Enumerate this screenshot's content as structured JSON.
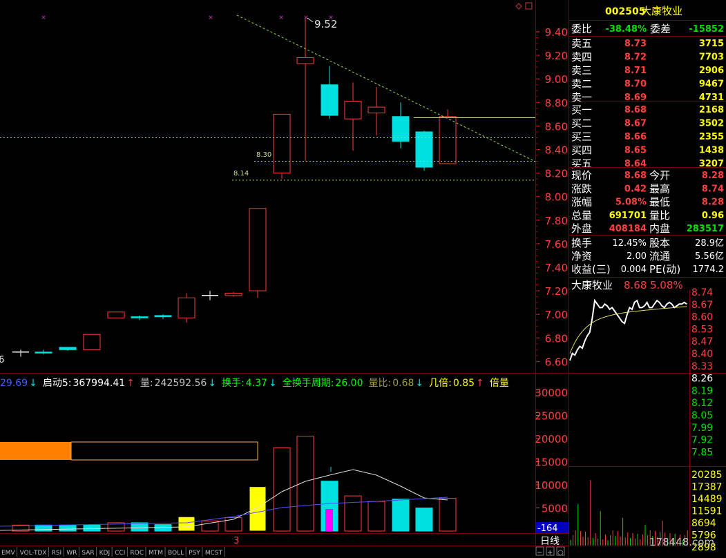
{
  "stock": {
    "code": "002505",
    "name": "大康牧业"
  },
  "colors": {
    "up": "#ff3c3c",
    "down": "#00e0e0",
    "yellow": "#ffff00",
    "green": "#00e000",
    "white": "#ffffff",
    "grid": "#7a0000",
    "orange": "#ff8000",
    "magenta": "#ff00ff"
  },
  "price_axis": {
    "ticks": [
      "9.40",
      "9.20",
      "9.00",
      "8.80",
      "8.60",
      "8.40",
      "8.20",
      "8.00",
      "7.80",
      "7.60",
      "7.40",
      "7.20",
      "7.00",
      "6.80",
      "6.60"
    ]
  },
  "volume_axis": {
    "ticks": [
      "30000",
      "25000",
      "20000",
      "15000",
      "10000",
      "5000"
    ]
  },
  "candles": [
    {
      "o": 6.67,
      "h": 6.7,
      "l": 6.64,
      "c": 6.68,
      "dir": "flat"
    },
    {
      "o": 6.68,
      "h": 6.7,
      "l": 6.66,
      "c": 6.68,
      "dir": "down"
    },
    {
      "o": 6.7,
      "h": 6.72,
      "l": 6.69,
      "c": 6.72,
      "dir": "down"
    },
    {
      "o": 6.7,
      "h": 6.83,
      "l": 6.7,
      "c": 6.83,
      "dir": "up"
    },
    {
      "o": 6.97,
      "h": 7.02,
      "l": 6.97,
      "c": 7.02,
      "dir": "up"
    },
    {
      "o": 6.97,
      "h": 6.99,
      "l": 6.95,
      "c": 6.98,
      "dir": "down"
    },
    {
      "o": 6.99,
      "h": 7.0,
      "l": 6.96,
      "c": 6.98,
      "dir": "down"
    },
    {
      "o": 6.97,
      "h": 7.18,
      "l": 6.93,
      "c": 7.14,
      "dir": "up"
    },
    {
      "o": 7.16,
      "h": 7.2,
      "l": 7.12,
      "c": 7.16,
      "dir": "flat"
    },
    {
      "o": 7.16,
      "h": 7.19,
      "l": 7.15,
      "c": 7.18,
      "dir": "up"
    },
    {
      "o": 7.2,
      "h": 7.9,
      "l": 7.14,
      "c": 7.9,
      "dir": "up"
    },
    {
      "o": 8.2,
      "h": 8.7,
      "l": 8.15,
      "c": 8.7,
      "dir": "up"
    },
    {
      "o": 9.13,
      "h": 9.52,
      "l": 8.3,
      "c": 9.18,
      "dir": "up"
    },
    {
      "o": 8.95,
      "h": 9.11,
      "l": 8.66,
      "c": 8.69,
      "dir": "down"
    },
    {
      "o": 8.66,
      "h": 8.97,
      "l": 8.39,
      "c": 8.81,
      "dir": "up"
    },
    {
      "o": 8.71,
      "h": 8.93,
      "l": 8.52,
      "c": 8.76,
      "dir": "up"
    },
    {
      "o": 8.68,
      "h": 8.8,
      "l": 8.41,
      "c": 8.47,
      "dir": "down"
    },
    {
      "o": 8.55,
      "h": 8.56,
      "l": 8.22,
      "c": 8.25,
      "dir": "down"
    },
    {
      "o": 8.28,
      "h": 8.74,
      "l": 8.28,
      "c": 8.68,
      "dir": "up"
    }
  ],
  "volumes": [
    {
      "v": 1300,
      "dir": "up"
    },
    {
      "v": 1300,
      "dir": "down"
    },
    {
      "v": 1300,
      "dir": "down"
    },
    {
      "v": 1300,
      "dir": "down"
    },
    {
      "v": 1800,
      "dir": "up"
    },
    {
      "v": 1800,
      "dir": "down"
    },
    {
      "v": 1400,
      "dir": "down"
    },
    {
      "v": 3100,
      "dir": "yellow"
    },
    {
      "v": 2200,
      "dir": "up"
    },
    {
      "v": 2900,
      "dir": "up"
    },
    {
      "v": 9600,
      "dir": "yellow"
    },
    {
      "v": 18000,
      "dir": "up"
    },
    {
      "v": 20500,
      "dir": "up"
    },
    {
      "v": 10800,
      "dir": "down"
    },
    {
      "v": 7600,
      "dir": "up"
    },
    {
      "v": 6400,
      "dir": "up"
    },
    {
      "v": 6900,
      "dir": "down"
    },
    {
      "v": 5000,
      "dir": "down"
    },
    {
      "v": 7100,
      "dir": "up"
    }
  ],
  "annotations": {
    "peak_label": "9.52",
    "support1": "8.30",
    "support2": "8.14",
    "left_cut": "6"
  },
  "indicator_bar": {
    "val0": "29.69",
    "qidong_label": "启动5:",
    "qidong_val": "367994.41",
    "liang_label": "量:",
    "liang_val": "242592.56",
    "huanshou_label": "换手:",
    "huanshou_val": "4.37",
    "quanhuan_label": "全换手周期:",
    "quanhuan_val": "26.00",
    "liangbi_label": "量比:",
    "liangbi_val": "0.68",
    "jibei_label": "几倍:",
    "jibei_val": "0.85",
    "beiliang_label": "倍量",
    "arrow_up": "↑",
    "arrow_down": "↓"
  },
  "orderbook": {
    "weibi_label": "委比",
    "weibi_val": "-38.48%",
    "weicha_label": "委差",
    "weicha_val": "-15852",
    "sells": [
      {
        "label": "卖五",
        "price": "8.73",
        "vol": "3715"
      },
      {
        "label": "卖四",
        "price": "8.72",
        "vol": "7703"
      },
      {
        "label": "卖三",
        "price": "8.71",
        "vol": "2906"
      },
      {
        "label": "卖二",
        "price": "8.70",
        "vol": "9467"
      },
      {
        "label": "卖一",
        "price": "8.69",
        "vol": "4731"
      }
    ],
    "buys": [
      {
        "label": "买一",
        "price": "8.68",
        "vol": "2168"
      },
      {
        "label": "买二",
        "price": "8.67",
        "vol": "3502"
      },
      {
        "label": "买三",
        "price": "8.66",
        "vol": "2355"
      },
      {
        "label": "买四",
        "price": "8.65",
        "vol": "1438"
      },
      {
        "label": "买五",
        "price": "8.64",
        "vol": "3207"
      }
    ]
  },
  "quote": {
    "xianjia_l": "现价",
    "xianjia": "8.68",
    "jinkai_l": "今开",
    "jinkai": "8.28",
    "zhangdie_l": "涨跌",
    "zhangdie": "0.42",
    "zuigao_l": "最高",
    "zuigao": "8.74",
    "zhangfu_l": "涨幅",
    "zhangfu": "5.08%",
    "zuidi_l": "最低",
    "zuidi": "8.28",
    "zongliang_l": "总量",
    "zongliang": "691701",
    "liangbi_l": "量比",
    "liangbi": "0.96",
    "waipan_l": "外盘",
    "waipan": "408184",
    "neipan_l": "内盘",
    "neipan": "283517",
    "huanshou_l": "换手",
    "huanshou": "12.45%",
    "guben_l": "股本",
    "guben": "28.9亿",
    "jingzi_l": "净资",
    "jingzi": "2.00",
    "liutong_l": "流通",
    "liutong": "5.56亿",
    "shouyi_l": "收益(三)",
    "shouyi": "0.004",
    "pe_l": "PE(动)",
    "pe": "1774.2"
  },
  "mini": {
    "name": "大康牧业",
    "price": "8.68",
    "pct": "5.08%",
    "price_ticks": [
      "8.74",
      "8.67",
      "8.60",
      "8.53",
      "8.47",
      "8.40",
      "8.33",
      "8.26",
      "8.19",
      "8.12",
      "8.05",
      "7.99",
      "7.92",
      "7.85"
    ],
    "vol_ticks": [
      "20285",
      "17387",
      "14489",
      "11591",
      "8694",
      "5796",
      "2898"
    ],
    "period": "日线",
    "neg_val": "-164",
    "watermark": "178448.com"
  },
  "tabs": [
    "EMV",
    "VOL-TDX",
    "RSI",
    "WR",
    "SAR",
    "KDJ",
    "CCI",
    "ROC",
    "MTM",
    "BOLL",
    "PSY",
    "MCST"
  ],
  "bottom_marker": "3"
}
